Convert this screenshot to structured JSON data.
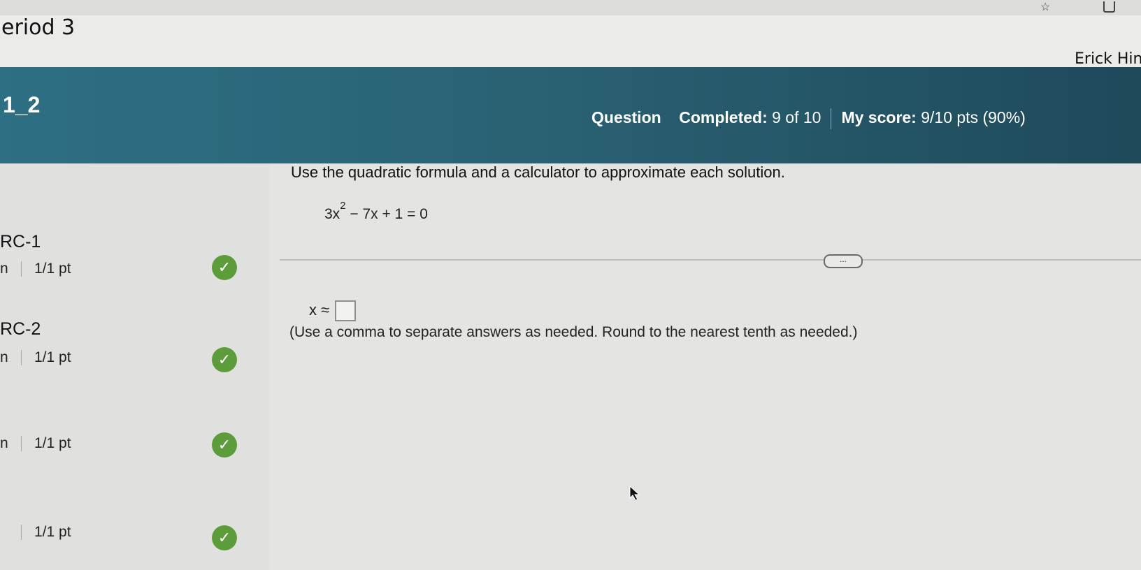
{
  "browser": {
    "star_icon": "star-icon",
    "extension_icon": "extension-icon"
  },
  "course": {
    "title": "eriod 3"
  },
  "user": {
    "name": "Erick Hinc"
  },
  "header": {
    "section_code": "1_2",
    "question_label": "Question",
    "completed_label": "Completed:",
    "completed_value": "9 of 10",
    "score_label": "My score:",
    "score_value": "9/10 pts (90%)"
  },
  "question_list": [
    {
      "label": "RC-1",
      "prefix": "n",
      "points": "1/1 pt",
      "status": "correct"
    },
    {
      "label": "RC-2",
      "prefix": "n",
      "points": "1/1 pt",
      "status": "correct"
    },
    {
      "label": "",
      "prefix": "n",
      "points": "1/1 pt",
      "status": "correct"
    },
    {
      "label": "",
      "prefix": "",
      "points": "1/1 pt",
      "status": "correct"
    }
  ],
  "problem": {
    "instruction": "Use the quadratic formula and a calculator to approximate each solution.",
    "equation_lead": "3x",
    "equation_exp": "2",
    "equation_rest": " − 7x + 1 = 0",
    "more_label": "...",
    "answer_prefix": "x ≈",
    "answer_value": "",
    "note": "(Use a comma to separate answers as needed. Round to the nearest tenth as needed.)"
  },
  "colors": {
    "header": "#2a6274",
    "check": "#5d9c3a"
  }
}
